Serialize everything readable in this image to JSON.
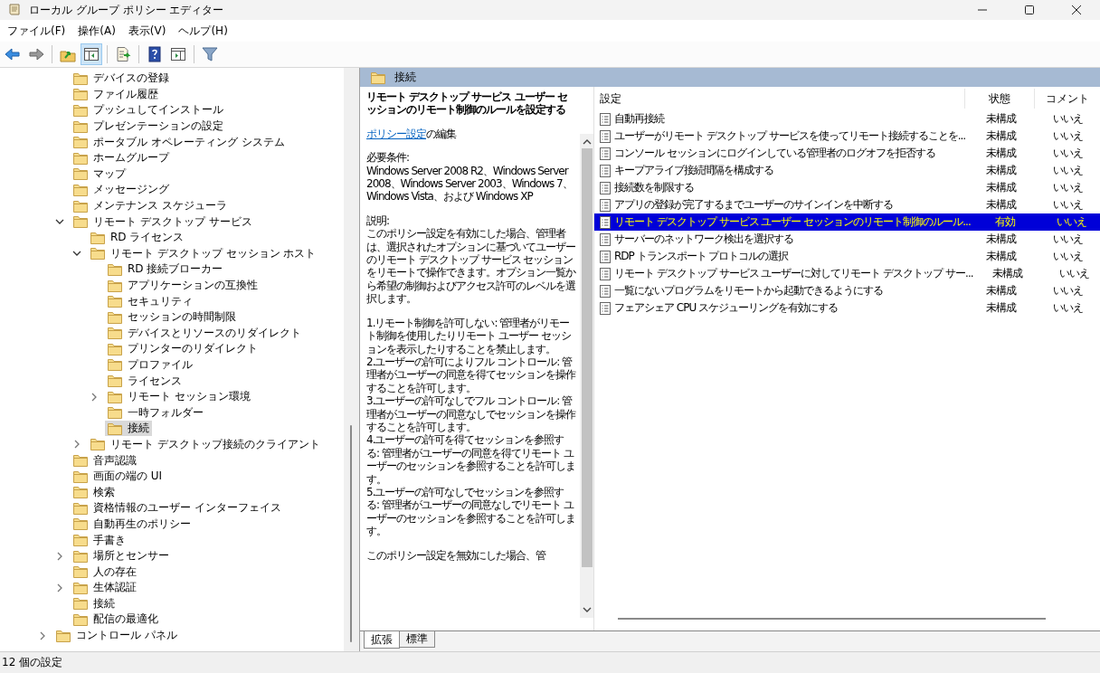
{
  "window": {
    "title": "ローカル グループ ポリシー エディター"
  },
  "menu": [
    "ファイル(F)",
    "操作(A)",
    "表示(V)",
    "ヘルプ(H)"
  ],
  "toolbar": [
    {
      "kind": "back",
      "pressed": false
    },
    {
      "kind": "forward",
      "pressed": false
    },
    {
      "kind": "sep"
    },
    {
      "kind": "up",
      "pressed": false
    },
    {
      "kind": "tree",
      "pressed": true
    },
    {
      "kind": "sep"
    },
    {
      "kind": "export",
      "pressed": false
    },
    {
      "kind": "sep"
    },
    {
      "kind": "help",
      "pressed": false
    },
    {
      "kind": "pane",
      "pressed": false
    },
    {
      "kind": "sep"
    },
    {
      "kind": "filter",
      "pressed": false
    }
  ],
  "tree": {
    "items": [
      {
        "children": [
          {
            "label": "デバイスの登録",
            "selected": false
          },
          {
            "label": "ファイル履歴",
            "selected": false
          },
          {
            "label": "プッシュしてインストール",
            "selected": false
          },
          {
            "label": "プレゼンテーションの設定",
            "selected": false
          },
          {
            "label": "ポータブル オペレーティング システム",
            "selected": false
          },
          {
            "label": "ホームグループ",
            "selected": false
          },
          {
            "label": "マップ",
            "selected": false
          },
          {
            "label": "メッセージング",
            "selected": false
          },
          {
            "label": "メンテナンス スケジューラ",
            "selected": false
          },
          {
            "label": "リモート デスクトップ サービス",
            "selected": false,
            "expanded": true,
            "children": [
              {
                "label": "RD ライセンス",
                "selected": false
              },
              {
                "label": "リモート デスクトップ セッション ホスト",
                "selected": false,
                "expanded": true,
                "children": [
                  {
                    "label": "RD 接続ブローカー",
                    "selected": false
                  },
                  {
                    "label": "アプリケーションの互換性",
                    "selected": false
                  },
                  {
                    "label": "セキュリティ",
                    "selected": false
                  },
                  {
                    "label": "セッションの時間制限",
                    "selected": false
                  },
                  {
                    "label": "デバイスとリソースのリダイレクト",
                    "selected": false
                  },
                  {
                    "label": "プリンターのリダイレクト",
                    "selected": false
                  },
                  {
                    "label": "プロファイル",
                    "selected": false
                  },
                  {
                    "label": "ライセンス",
                    "selected": false
                  },
                  {
                    "label": "リモート セッション環境",
                    "selected": false,
                    "expanded": false
                  },
                  {
                    "label": "一時フォルダー",
                    "selected": false
                  },
                  {
                    "label": "接続",
                    "selected": true
                  }
                ]
              },
              {
                "label": "リモート デスクトップ接続のクライアント",
                "selected": false,
                "expanded": false
              }
            ]
          },
          {
            "label": "音声認識",
            "selected": false
          },
          {
            "label": "画面の端の UI",
            "selected": false
          },
          {
            "label": "検索",
            "selected": false
          },
          {
            "label": "資格情報のユーザー インターフェイス",
            "selected": false
          },
          {
            "label": "自動再生のポリシー",
            "selected": false
          },
          {
            "label": "手書き",
            "selected": false
          },
          {
            "label": "場所とセンサー",
            "selected": false,
            "expanded": false
          },
          {
            "label": "人の存在",
            "selected": false
          },
          {
            "label": "生体認証",
            "selected": false,
            "expanded": false
          },
          {
            "label": "接続",
            "selected": false
          },
          {
            "label": "配信の最適化",
            "selected": false
          }
        ]
      },
      {
        "label": "コントロール パネル",
        "selected": false,
        "expanded": false
      }
    ]
  },
  "header": {
    "title": "接続"
  },
  "description": {
    "title": "リモート デスクトップ サービス ユーザー セッションのリモート制御のルールを設定する",
    "edit_link": "ポリシー設定",
    "edit_text": "の編集",
    "blocks": [
      [
        "必要条件:",
        "Windows Server 2008 R2、Windows Server 2008、Windows Server 2003、Windows 7、Windows Vista、および Windows XP"
      ],
      [
        "説明:",
        "このポリシー設定を有効にした場合、管理者は、選択されたオプションに基づいてユーザーのリモート デスクトップ サービス セッションをリモートで操作できます。オプション一覧から希望の制御およびアクセス許可のレベルを選択します。"
      ],
      [
        "1.リモート制御を許可しない: 管理者がリモート制御を使用したりリモート ユーザー セッションを表示したりすることを禁止します。",
        "2.ユーザーの許可によりフル コントロール: 管理者がユーザーの同意を得てセッションを操作することを許可します。",
        "3.ユーザーの許可なしでフル コントロール: 管理者がユーザーの同意なしでセッションを操作することを許可します。",
        "4.ユーザーの許可を得てセッションを参照する: 管理者がユーザーの同意を得てリモート ユーザーのセッションを参照することを許可します。",
        "5.ユーザーの許可なしでセッションを参照する: 管理者がユーザーの同意なしでリモート ユーザーのセッションを参照することを許可します。"
      ],
      [
        "このポリシー設定を無効にした場合、管"
      ]
    ]
  },
  "table": {
    "columns": [
      "設定",
      "状態",
      "コメント"
    ],
    "rows": [
      {
        "cells": [
          "自動再接続",
          "未構成",
          "いいえ"
        ],
        "selected": false
      },
      {
        "cells": [
          "ユーザーがリモート デスクトップ サービスを使ってリモート接続することを...",
          "未構成",
          "いいえ"
        ],
        "selected": false
      },
      {
        "cells": [
          "コンソール セッションにログインしている管理者のログオフを拒否する",
          "未構成",
          "いいえ"
        ],
        "selected": false
      },
      {
        "cells": [
          "キープアライブ接続間隔を構成する",
          "未構成",
          "いいえ"
        ],
        "selected": false
      },
      {
        "cells": [
          "接続数を制限する",
          "未構成",
          "いいえ"
        ],
        "selected": false
      },
      {
        "cells": [
          "アプリの登録が完了するまでユーザーのサインインを中断する",
          "未構成",
          "いいえ"
        ],
        "selected": false
      },
      {
        "cells": [
          "リモート デスクトップ サービス ユーザー セッションのリモート制御のルール...",
          "有効",
          "いいえ"
        ],
        "selected": true
      },
      {
        "cells": [
          "サーバーのネットワーク検出を選択する",
          "未構成",
          "いいえ"
        ],
        "selected": false
      },
      {
        "cells": [
          "RDP トランスポート プロトコルの選択",
          "未構成",
          "いいえ"
        ],
        "selected": false
      },
      {
        "cells": [
          "リモート デスクトップ サービス ユーザーに対してリモート デスクトップ サー...",
          "未構成",
          "いいえ"
        ],
        "selected": false
      },
      {
        "cells": [
          "一覧にないプログラムをリモートから起動できるようにする",
          "未構成",
          "いいえ"
        ],
        "selected": false
      },
      {
        "cells": [
          "フェアシェア CPU スケジューリングを有効にする",
          "未構成",
          "いいえ"
        ],
        "selected": false
      }
    ]
  },
  "tabs": [
    {
      "label": "拡張",
      "selected": true
    },
    {
      "label": "標準",
      "selected": false
    }
  ],
  "status_bar": {
    "text": "12 個の設定"
  }
}
